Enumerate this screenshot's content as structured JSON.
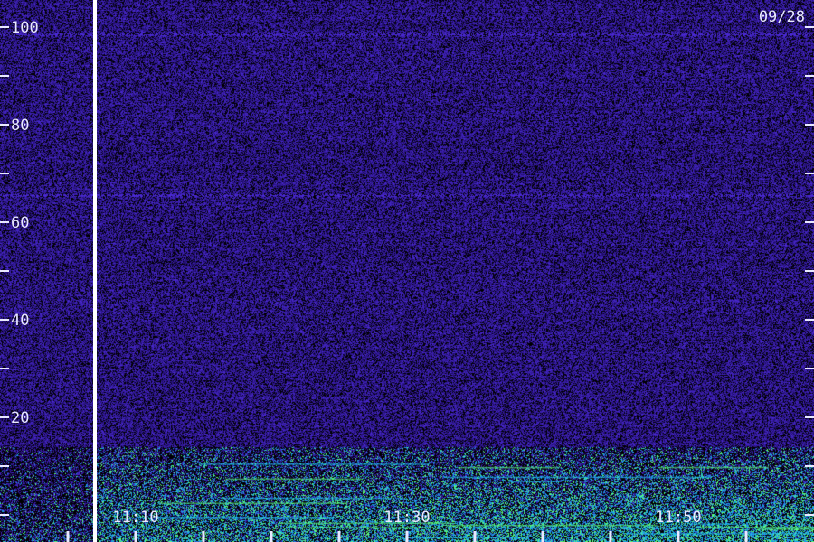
{
  "chart_data": {
    "type": "heatmap",
    "title": "",
    "xlabel": "",
    "ylabel": "",
    "date": "09/28",
    "ylim": [
      0,
      100
    ],
    "y_major_ticks": [
      20,
      40,
      60,
      80,
      100
    ],
    "y_minor_ticks": [
      10,
      30,
      50,
      70,
      90
    ],
    "y_tick_labels": [
      "20",
      "40",
      "60",
      "80",
      "100"
    ],
    "x_time_labels": [
      "11:10",
      "11:30",
      "11:50"
    ],
    "x_range_minutes": [
      "11:00",
      "12:00"
    ],
    "x_tick_interval_minutes": 5,
    "data_gap_time": "11:07",
    "horizontal_lines": [
      {
        "y": 98.5,
        "color": "#3a6cff"
      },
      {
        "y": 65.5,
        "color": "#3a3aff"
      }
    ],
    "low_band_y_max": 14,
    "colors": {
      "background": "#000000",
      "noise_low": "#1a0a5a",
      "noise_high": "#4b2ad6",
      "band_cyan": "#23c6ff",
      "band_green": "#5bff7a",
      "gap_line": "#ffffff",
      "text": "#e8e8ff"
    }
  }
}
